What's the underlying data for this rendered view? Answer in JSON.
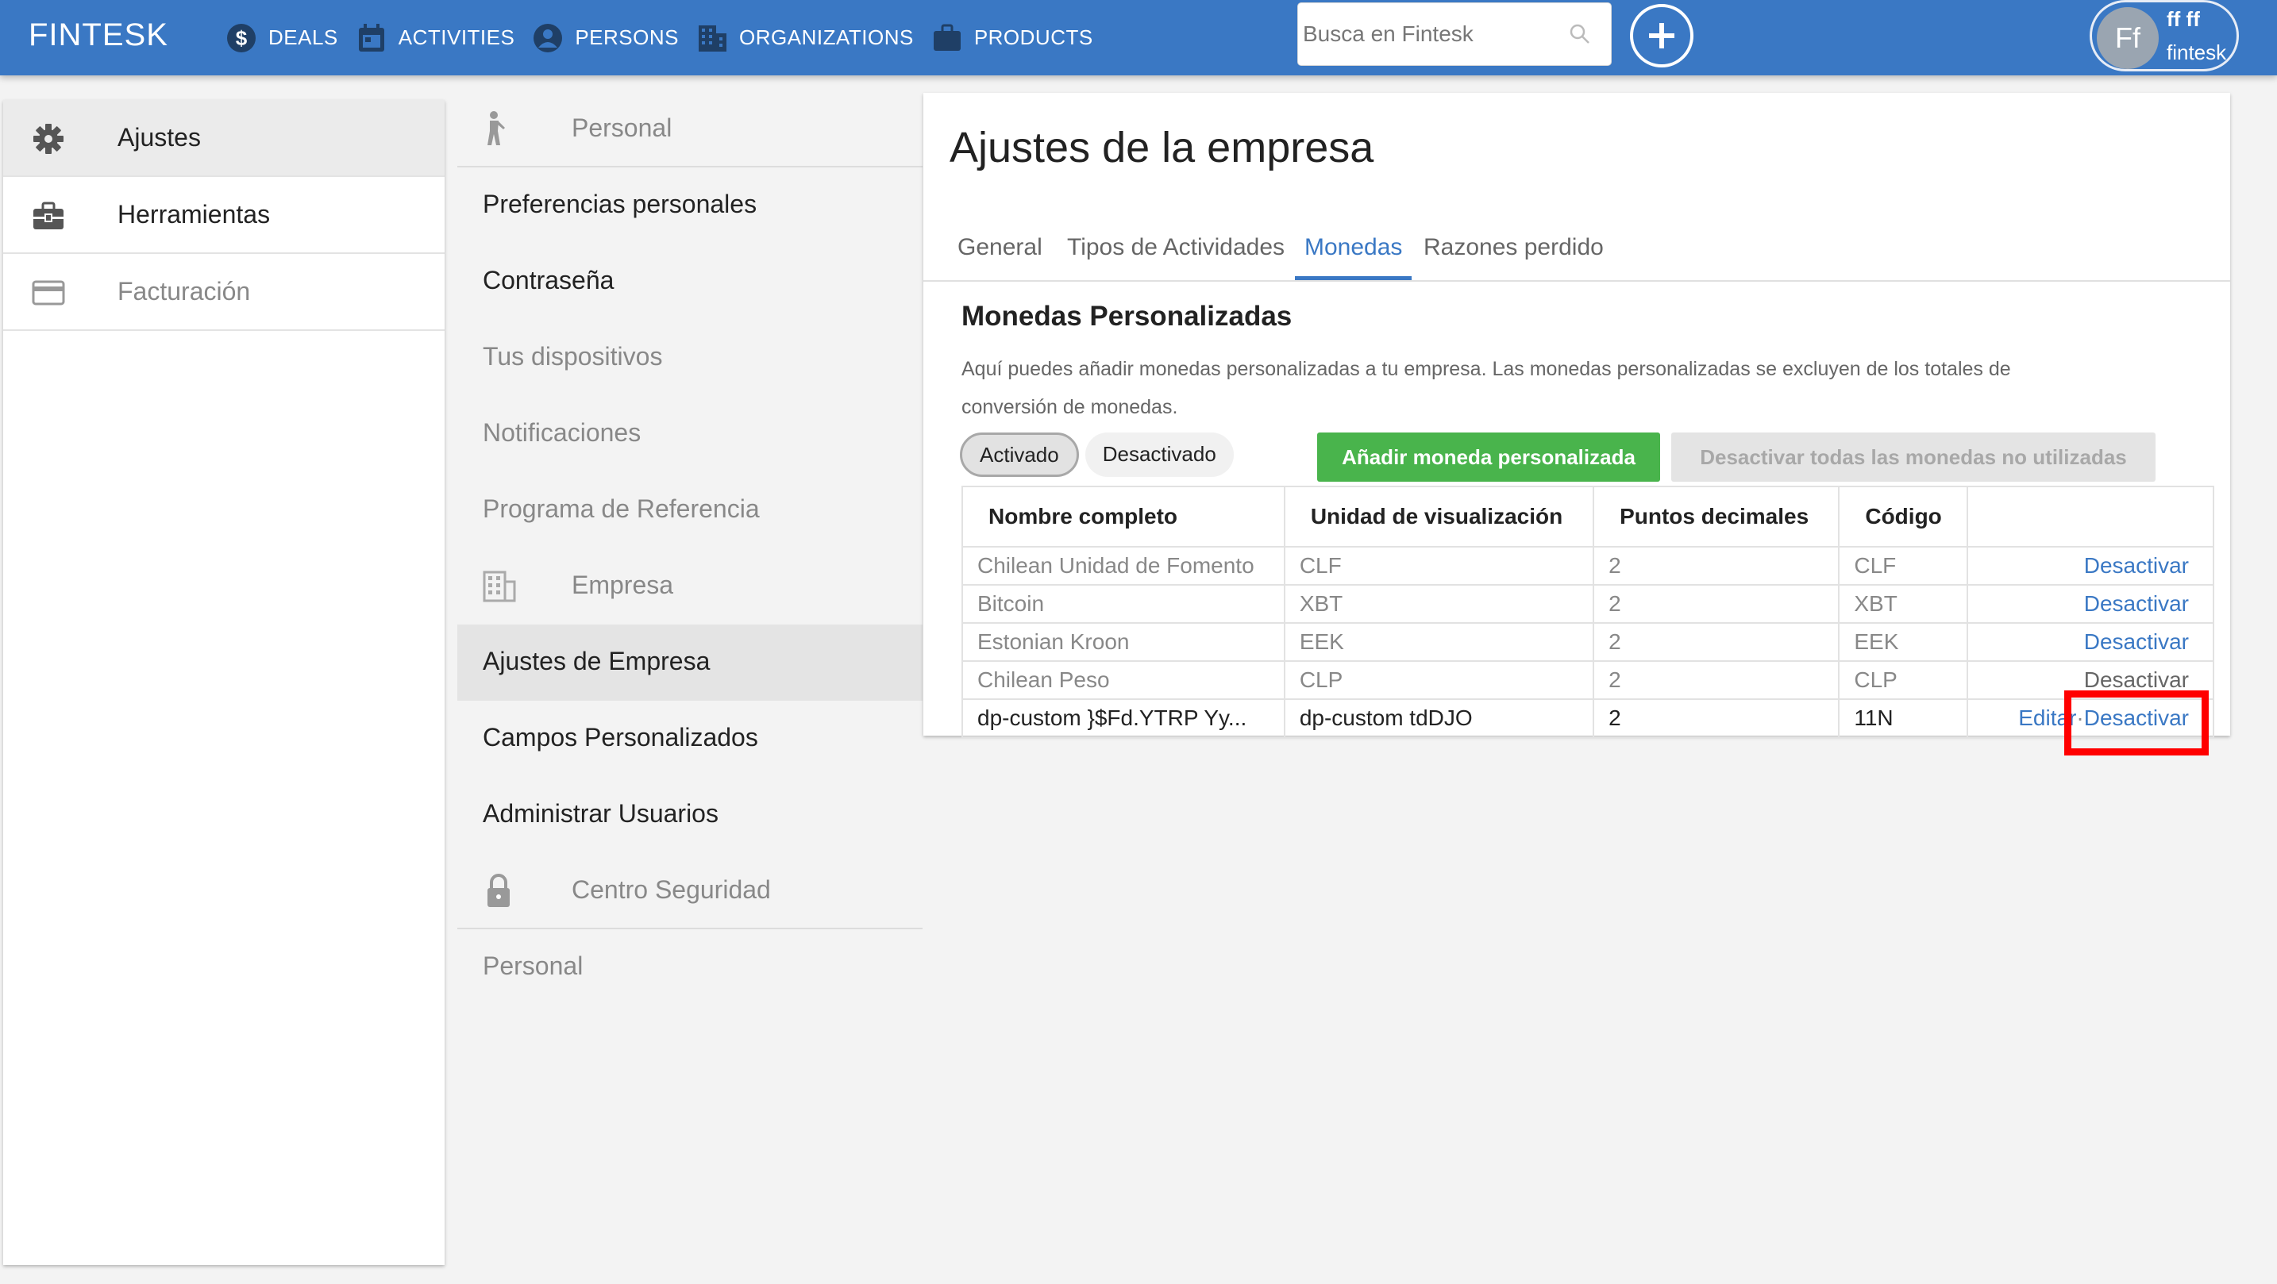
{
  "header": {
    "brand": "FINTESK",
    "nav": [
      {
        "label": "DEALS",
        "icon": "dollar-icon"
      },
      {
        "label": "ACTIVITIES",
        "icon": "calendar-icon"
      },
      {
        "label": "PERSONS",
        "icon": "person-icon"
      },
      {
        "label": "ORGANIZATIONS",
        "icon": "building-icon"
      },
      {
        "label": "PRODUCTS",
        "icon": "briefcase-icon"
      }
    ],
    "search_placeholder": "Busca en Fintesk",
    "user": {
      "initials": "Ff",
      "name": "ff ff",
      "company": "fintesk"
    }
  },
  "left_menu": {
    "items": [
      {
        "label": "Ajustes",
        "icon": "gear-icon",
        "active": true
      },
      {
        "label": "Herramientas",
        "icon": "toolbox-icon"
      },
      {
        "label": "Facturación",
        "icon": "credit-card-icon"
      }
    ]
  },
  "settings_menu": {
    "personal_section": "Personal",
    "preferencias": "Preferencias personales",
    "contrasena": "Contraseña",
    "dispositivos": "Tus dispositivos",
    "notificaciones": "Notificaciones",
    "referencia": "Programa de Referencia",
    "empresa_section": "Empresa",
    "ajustes_empresa": "Ajustes de Empresa",
    "campos": "Campos Personalizados",
    "usuarios": "Administrar Usuarios",
    "seguridad_section": "Centro Seguridad",
    "personal_bottom": "Personal"
  },
  "main": {
    "title": "Ajustes de la empresa",
    "tabs": [
      {
        "label": "General"
      },
      {
        "label": "Tipos de Actividades"
      },
      {
        "label": "Monedas",
        "active": true
      },
      {
        "label": "Razones perdido"
      }
    ],
    "section_title": "Monedas Personalizadas",
    "section_desc": "Aquí puedes añadir monedas personalizadas a tu empresa. Las monedas personalizadas se excluyen de los totales de conversión de monedas.",
    "toggle": {
      "active": "Activado",
      "inactive": "Desactivado"
    },
    "add_button": "Añadir moneda personalizada",
    "deactivate_all_button": "Desactivar todas las monedas no utilizadas",
    "table": {
      "headers": [
        "Nombre completo",
        "Unidad de visualización",
        "Puntos decimales",
        "Código",
        ""
      ],
      "rows": [
        {
          "name": "Chilean Unidad de Fomento",
          "unit": "CLF",
          "decimals": "2",
          "code": "CLF",
          "action": "Desactivar"
        },
        {
          "name": "Bitcoin",
          "unit": "XBT",
          "decimals": "2",
          "code": "XBT",
          "action": "Desactivar"
        },
        {
          "name": "Estonian Kroon",
          "unit": "EEK",
          "decimals": "2",
          "code": "EEK",
          "action": "Desactivar"
        },
        {
          "name": "Chilean Peso",
          "unit": "CLP",
          "decimals": "2",
          "code": "CLP",
          "action": "Desactivar"
        },
        {
          "name": "dp-custom }$Fd.YTRP Yy...",
          "unit": "dp-custom tdDJO",
          "decimals": "2",
          "code": "11N",
          "edit": "Editar",
          "separator": "·",
          "action": "Desactivar"
        }
      ]
    }
  },
  "colors": {
    "topbar": "#3a78c4",
    "accent": "#3a78c4",
    "green": "#49b44c",
    "highlight": "#ff0000"
  }
}
